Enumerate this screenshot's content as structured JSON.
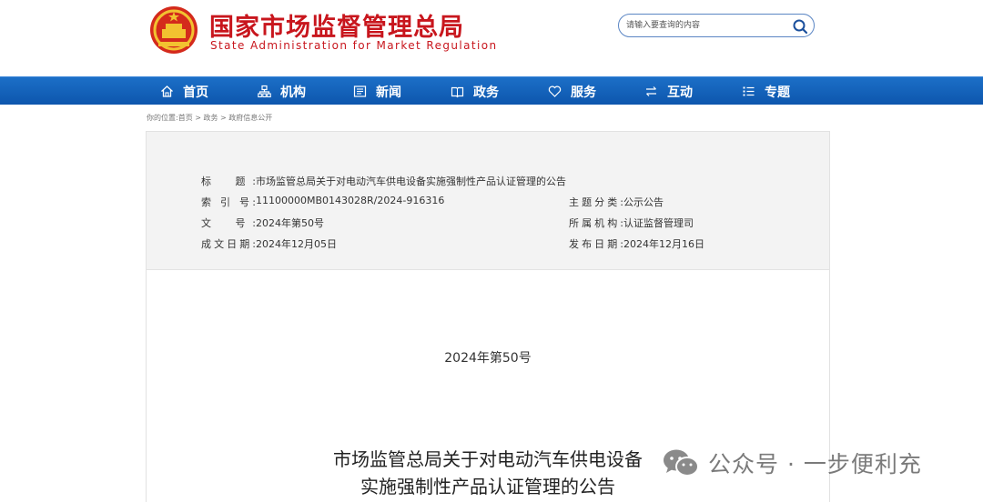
{
  "header": {
    "title_cn": "国家市场监督管理总局",
    "title_en": "State Administration for Market Regulation",
    "search_placeholder": "请输入要查询的内容"
  },
  "nav": [
    {
      "label": "首页",
      "icon": "home-icon"
    },
    {
      "label": "机构",
      "icon": "org-chart-icon"
    },
    {
      "label": "新闻",
      "icon": "news-icon"
    },
    {
      "label": "政务",
      "icon": "government-icon"
    },
    {
      "label": "服务",
      "icon": "heart-icon"
    },
    {
      "label": "互动",
      "icon": "exchange-icon"
    },
    {
      "label": "专题",
      "icon": "list-icon"
    }
  ],
  "breadcrumb": "你的位置:首页 > 政务 > 政府信息公开",
  "meta": {
    "title_label": "标　题:",
    "title_value": "市场监管总局关于对电动汽车供电设备实施强制性产品认证管理的公告",
    "index_label": "索 引 号:",
    "index_value": "11100000MB0143028R/2024-916316",
    "topic_label": "主题分类:",
    "topic_value": "公示公告",
    "doc_label": "文　号:",
    "doc_value": "2024年第50号",
    "org_label": "所属机构:",
    "org_value": "认证监督管理司",
    "created_label": "成文日期:",
    "created_value": "2024年12月05日",
    "published_label": "发布日期:",
    "published_value": "2024年12月16日"
  },
  "document": {
    "number": "2024年第50号",
    "title_line1": "市场监管总局关于对电动汽车供电设备",
    "title_line2": "实施强制性产品认证管理的公告"
  },
  "watermark": "公众号 · 一步便利充",
  "colors": {
    "brand_red": "#c8161d",
    "nav_blue": "#0d56ad"
  }
}
